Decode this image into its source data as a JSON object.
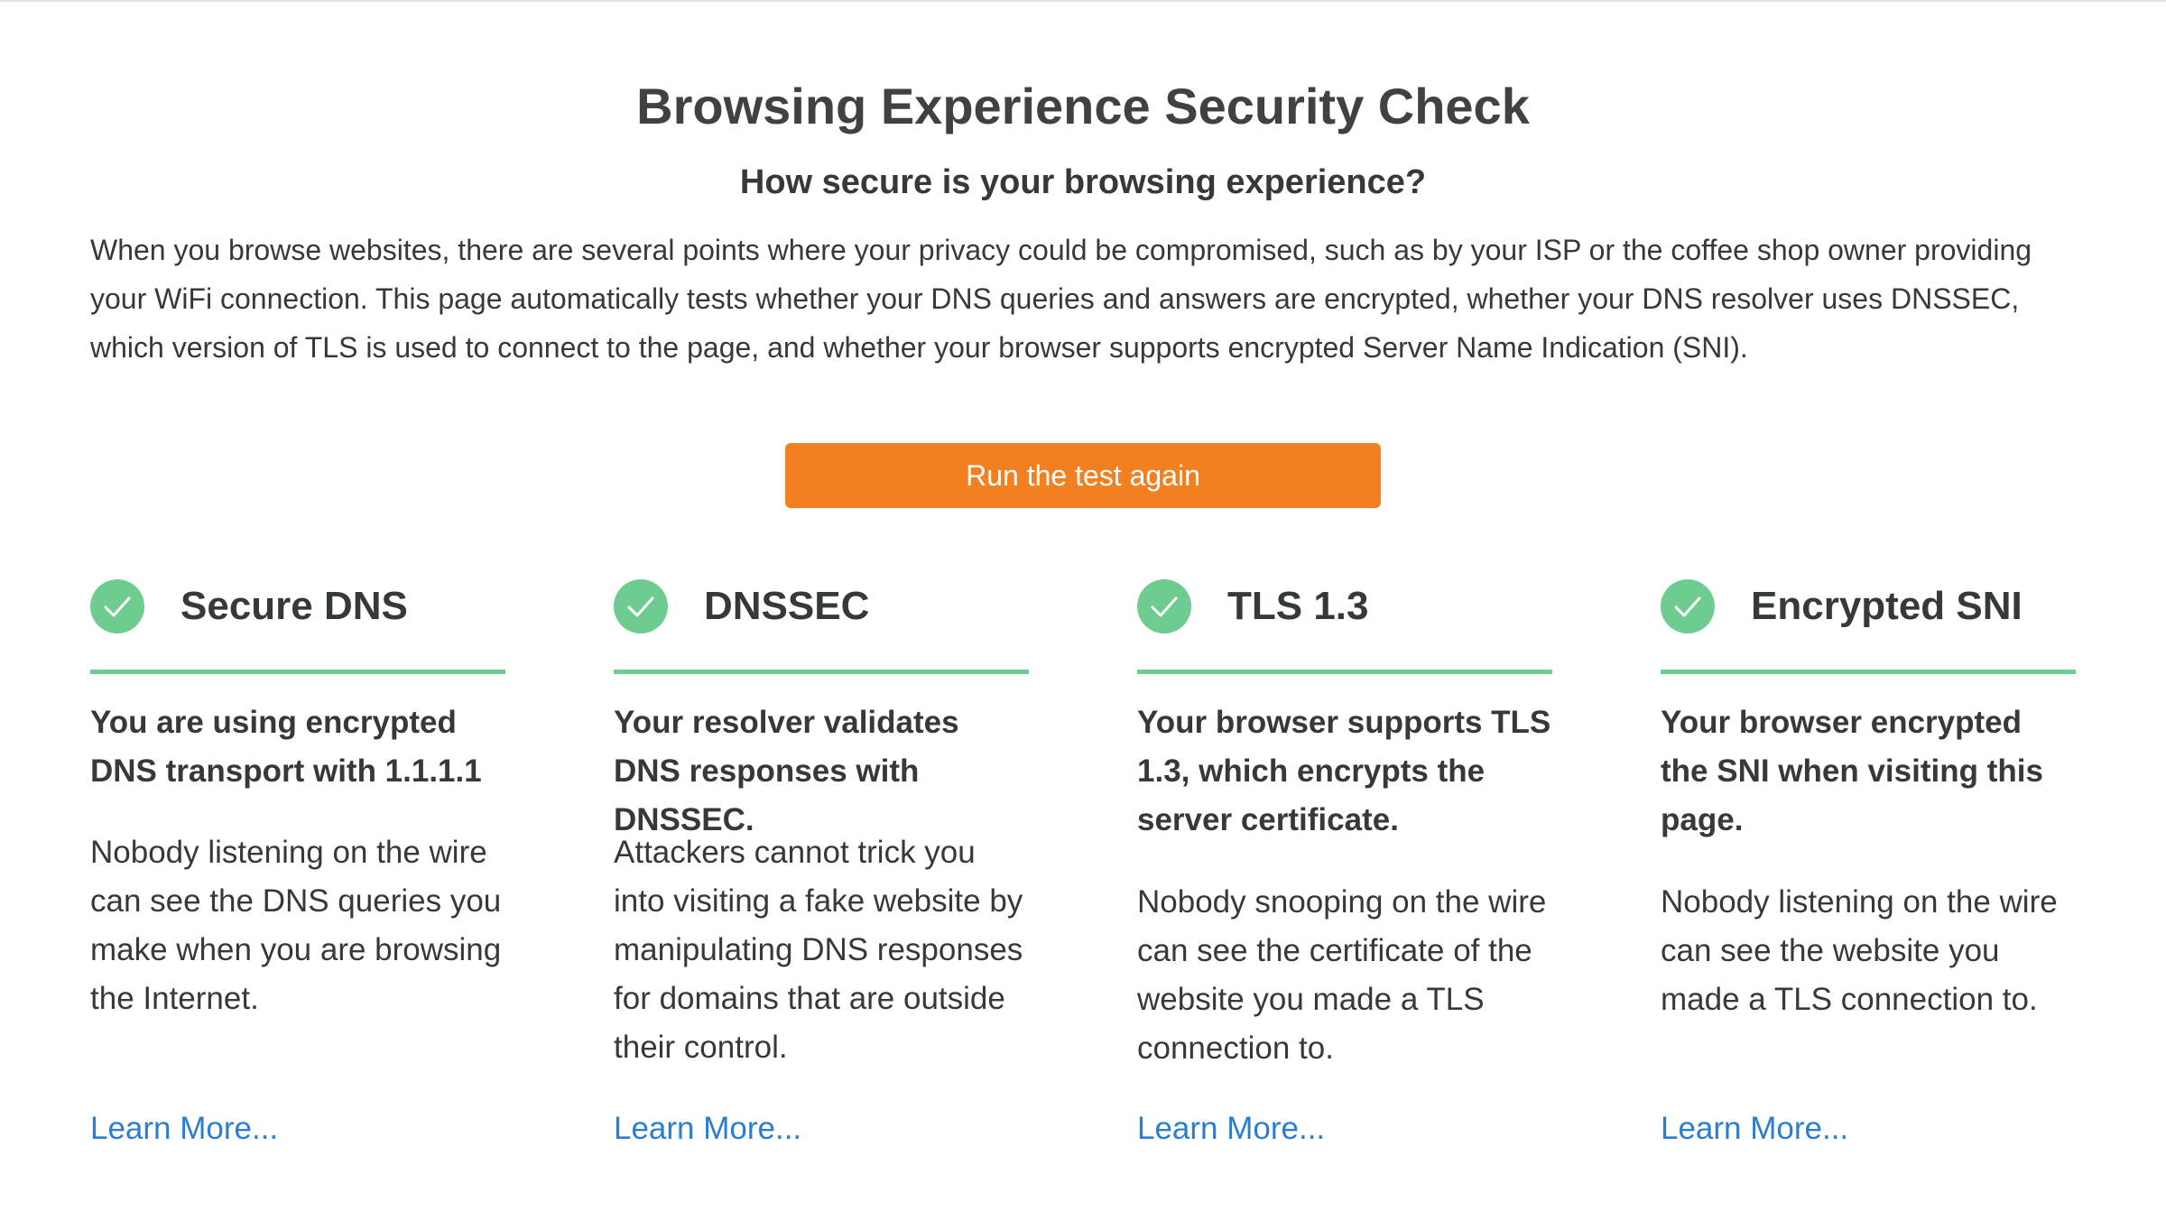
{
  "page": {
    "title": "Browsing Experience Security Check",
    "subtitle": "How secure is your browsing experience?",
    "intro": "When you browse websites, there are several points where your privacy could be compromised, such as by your ISP or the coffee shop owner providing your WiFi connection. This page automatically tests whether your DNS queries and answers are encrypted, whether your DNS resolver uses DNSSEC, which version of TLS is used to connect to the page, and whether your browser supports encrypted Server Name Indication (SNI).",
    "run_button_label": "Run the test again"
  },
  "colors": {
    "accent_button": "#f38020",
    "success_green": "#6fcc90",
    "link_blue": "#2c7cd0",
    "text": "#36393a"
  },
  "cards": [
    {
      "icon": "check-icon",
      "status": "pass",
      "title": "Secure DNS",
      "summary": "You are using encrypted DNS transport with 1.1.1.1",
      "body": "Nobody listening on the wire can see the DNS queries you make when you are browsing the Internet.",
      "link_label": "Learn More..."
    },
    {
      "icon": "check-icon",
      "status": "pass",
      "title": "DNSSEC",
      "summary": "Your resolver validates DNS responses with DNSSEC.",
      "body": "Attackers cannot trick you into visiting a fake website by manipulating DNS responses for domains that are outside their control.",
      "link_label": "Learn More..."
    },
    {
      "icon": "check-icon",
      "status": "pass",
      "title": "TLS 1.3",
      "summary": "Your browser supports TLS 1.3, which encrypts the server certificate.",
      "body": "Nobody snooping on the wire can see the certificate of the website you made a TLS connection to.",
      "link_label": "Learn More..."
    },
    {
      "icon": "check-icon",
      "status": "pass",
      "title": "Encrypted SNI",
      "summary": "Your browser encrypted the SNI when visiting this page.",
      "body": "Nobody listening on the wire can see the website you made a TLS connection to.",
      "link_label": "Learn More..."
    }
  ]
}
